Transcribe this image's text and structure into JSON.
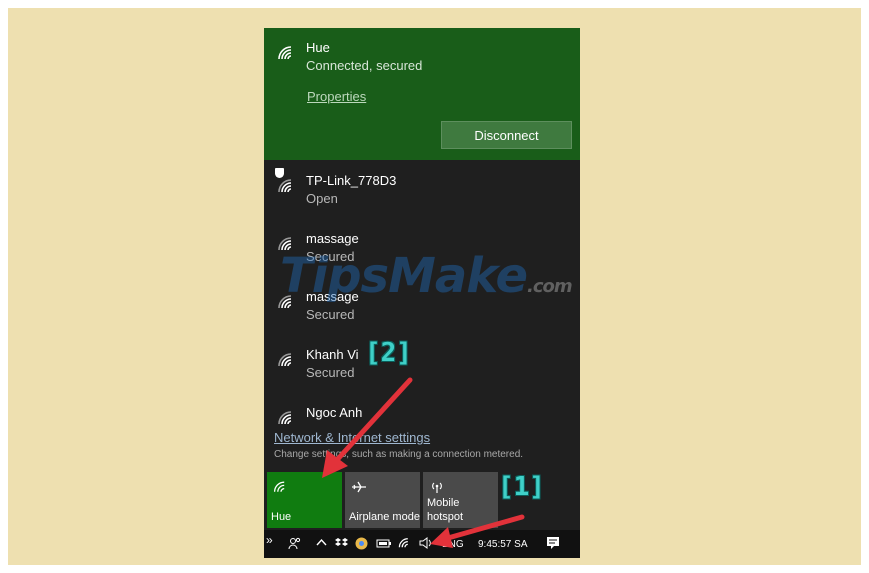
{
  "connected_network": {
    "name": "Hue",
    "status": "Connected, secured",
    "properties_label": "Properties",
    "disconnect_label": "Disconnect"
  },
  "networks": [
    {
      "name": "TP-Link_778D3",
      "status": "Open"
    },
    {
      "name": "massage",
      "status": "Secured"
    },
    {
      "name": "massage",
      "status": "Secured"
    },
    {
      "name": "Khanh Vi",
      "status": "Secured"
    },
    {
      "name": "Ngoc Anh",
      "status": ""
    }
  ],
  "settings": {
    "link": "Network & Internet settings",
    "description": "Change settings, such as making a connection metered."
  },
  "tiles": [
    {
      "label": "Hue",
      "icon": "wifi-icon",
      "active": true
    },
    {
      "label": "Airplane mode",
      "icon": "airplane-icon",
      "active": false
    },
    {
      "label": "Mobile hotspot",
      "icon": "hotspot-icon",
      "active": false
    }
  ],
  "taskbar": {
    "overflow": "»",
    "language": "ENG",
    "time": "9:45:57 SA"
  },
  "annotations": {
    "first": "[1]",
    "second": "[2]"
  },
  "watermark": {
    "brand": "TipsMake",
    "suffix": ".com"
  },
  "colors": {
    "background": "#eee0b0",
    "panel": "#1f1f1f",
    "connected": "#195d19",
    "tile_active": "#107c10",
    "tile_inactive": "#4a4a4a",
    "arrow": "#e2323a",
    "annotation": "#3fd0c8"
  }
}
